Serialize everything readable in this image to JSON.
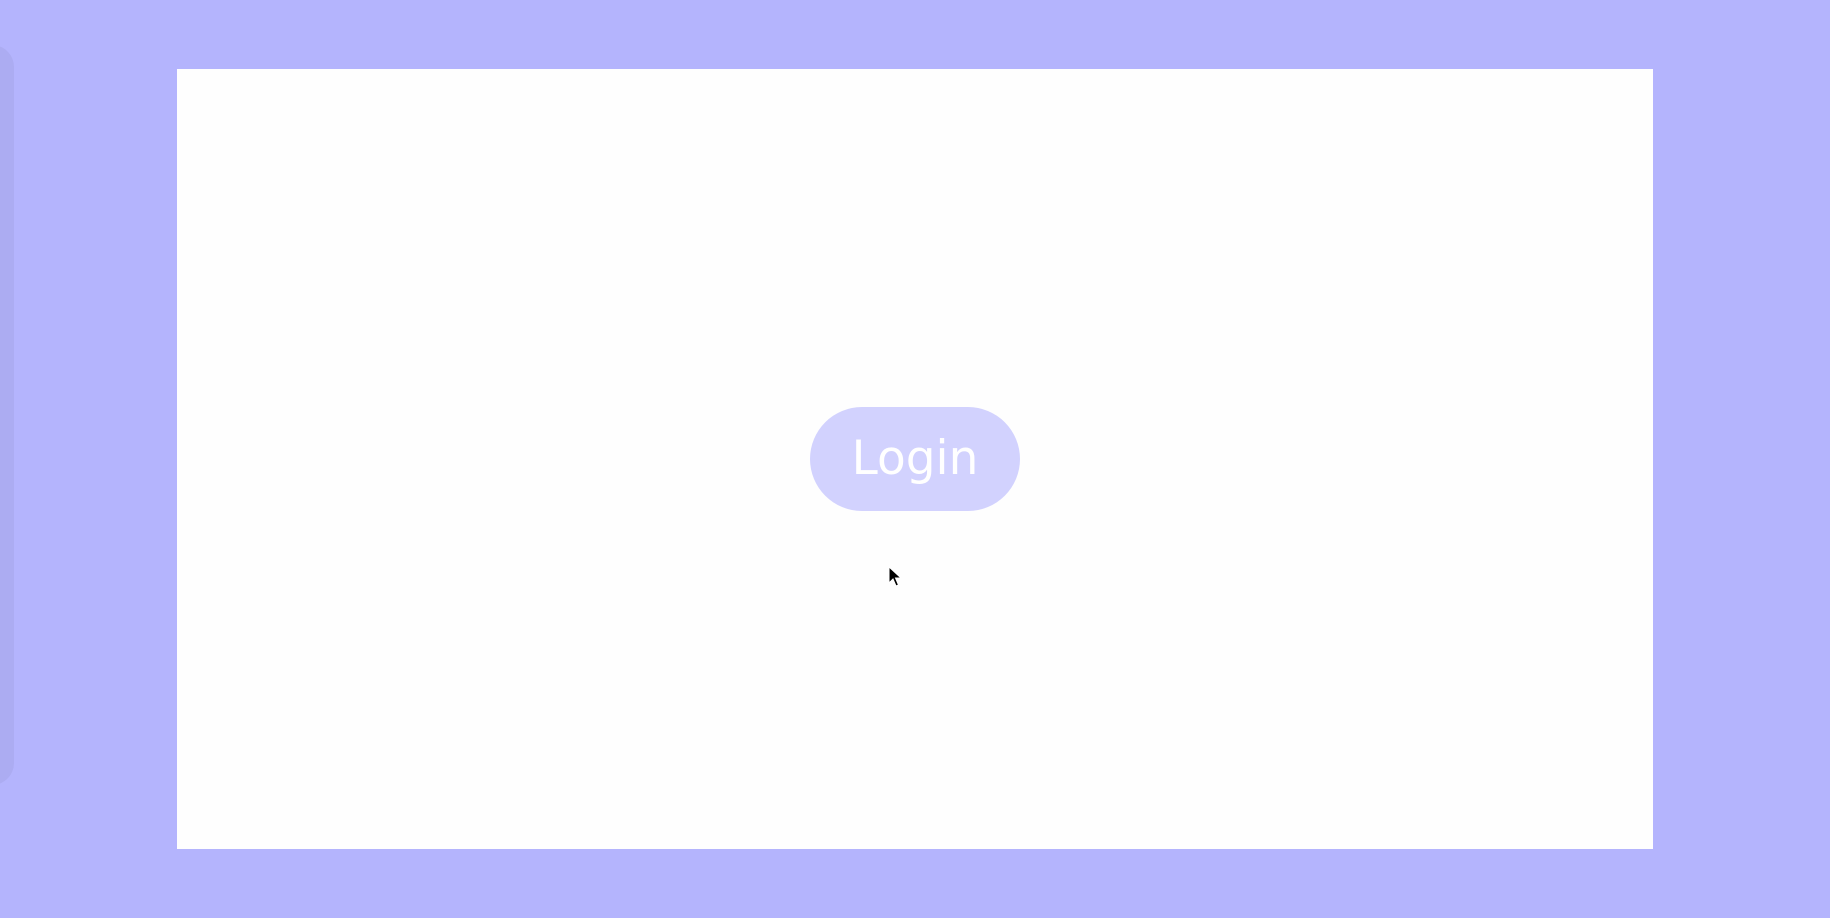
{
  "theme": {
    "backdrop_color": "#b4b4fd",
    "canvas_color": "#fefefe",
    "button_color": "#d2d2fe",
    "button_text_color": "#ffffff"
  },
  "login_button": {
    "label": "Login"
  },
  "cursor": {
    "icon": "arrow-pointer-icon"
  }
}
